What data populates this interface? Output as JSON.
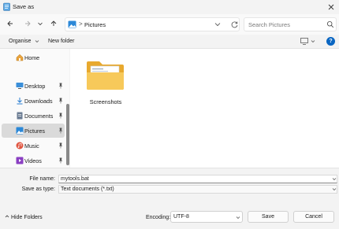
{
  "window": {
    "title": "Save as"
  },
  "address": {
    "location": "Pictures",
    "separator": ">"
  },
  "search": {
    "placeholder": "Search Pictures"
  },
  "commands": {
    "organise": "Organise",
    "new_folder": "New folder",
    "help": "?"
  },
  "sidebar": {
    "items": [
      {
        "label": "Home",
        "icon": "home-icon",
        "pinned": false,
        "selected": false
      },
      {
        "label": "Desktop",
        "icon": "desktop-icon",
        "pinned": true,
        "selected": false
      },
      {
        "label": "Downloads",
        "icon": "download-icon",
        "pinned": true,
        "selected": false
      },
      {
        "label": "Documents",
        "icon": "documents-icon",
        "pinned": true,
        "selected": false
      },
      {
        "label": "Pictures",
        "icon": "pictures-icon",
        "pinned": true,
        "selected": true
      },
      {
        "label": "Music",
        "icon": "music-icon",
        "pinned": true,
        "selected": false
      },
      {
        "label": "Videos",
        "icon": "videos-icon",
        "pinned": true,
        "selected": false
      }
    ]
  },
  "content": {
    "items": [
      {
        "label": "Screenshots",
        "type": "folder"
      }
    ]
  },
  "form": {
    "file_name_label": "File name:",
    "file_name_value": "mytools.bat",
    "save_as_type_label": "Save as type:",
    "save_as_type_value": "Text documents (*.txt)"
  },
  "footer": {
    "hide_folders": "Hide Folders",
    "encoding_label": "Encoding:",
    "encoding_value": "UTF-8",
    "save": "Save",
    "cancel": "Cancel"
  },
  "colors": {
    "accent": "#0a66c2",
    "folder": "#f5c350",
    "selected": "#dadada"
  }
}
